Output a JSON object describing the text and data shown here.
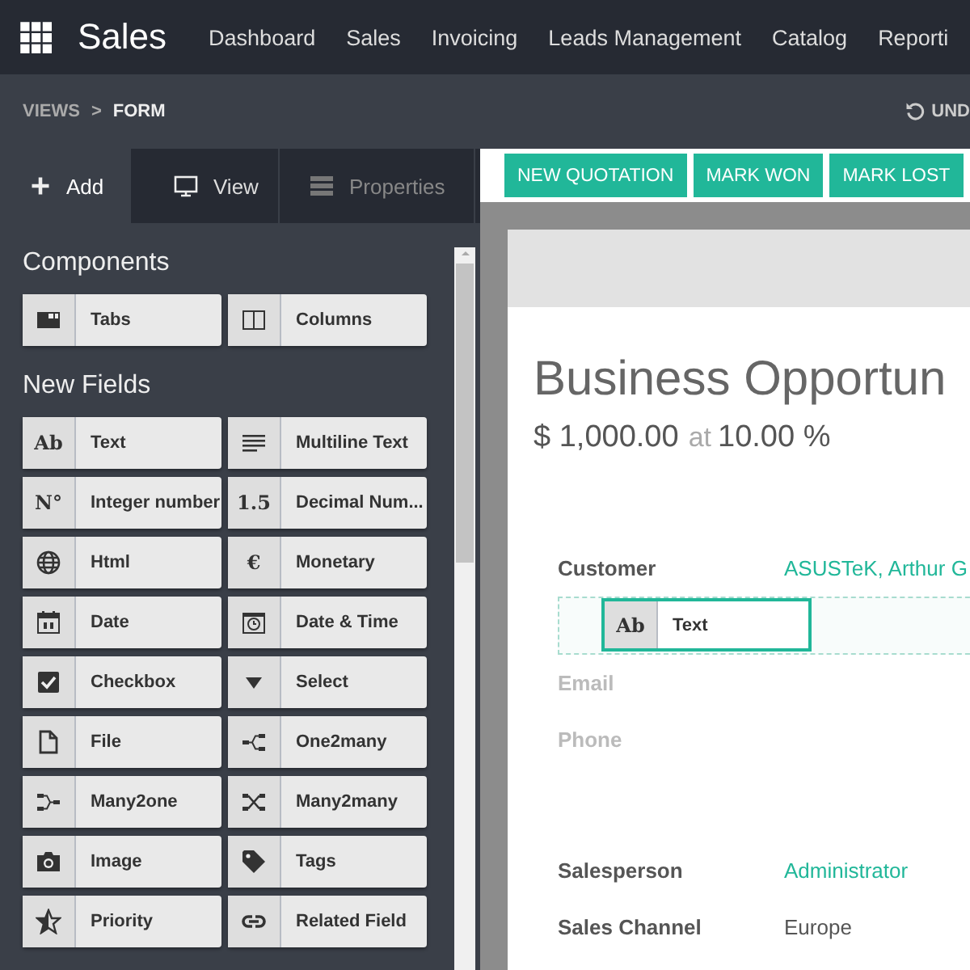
{
  "topbar": {
    "app": "Sales",
    "menu": [
      "Dashboard",
      "Sales",
      "Invoicing",
      "Leads Management",
      "Catalog",
      "Reporti"
    ]
  },
  "breadcrumb": {
    "items": [
      "VIEWS",
      "FORM"
    ],
    "separator": ">",
    "undo": "UND"
  },
  "sidebar": {
    "tabs": [
      {
        "label": "Add",
        "kind": "plus",
        "selected": true,
        "disabled": false
      },
      {
        "label": "View",
        "kind": "monitor",
        "selected": false,
        "disabled": false
      },
      {
        "label": "Properties",
        "kind": "server",
        "selected": false,
        "disabled": true
      }
    ],
    "sections": [
      {
        "title": "Components",
        "items": [
          {
            "label": "Tabs",
            "kind": "tabs"
          },
          {
            "label": "Columns",
            "kind": "columns"
          }
        ]
      },
      {
        "title": "New Fields",
        "items": [
          {
            "label": "Text",
            "kind": "glyph",
            "glyph": "Ab"
          },
          {
            "label": "Multiline Text",
            "kind": "lines"
          },
          {
            "label": "Integer number",
            "kind": "glyph",
            "glyph": "N°"
          },
          {
            "label": "Decimal Num...",
            "kind": "glyph",
            "glyph": "1.5"
          },
          {
            "label": "Html",
            "kind": "globe"
          },
          {
            "label": "Monetary",
            "kind": "glyph",
            "glyph": "€"
          },
          {
            "label": "Date",
            "kind": "calendar"
          },
          {
            "label": "Date & Time",
            "kind": "clock"
          },
          {
            "label": "Checkbox",
            "kind": "checkbox"
          },
          {
            "label": "Select",
            "kind": "caret"
          },
          {
            "label": "File",
            "kind": "file"
          },
          {
            "label": "One2many",
            "kind": "one2many"
          },
          {
            "label": "Many2one",
            "kind": "many2one"
          },
          {
            "label": "Many2many",
            "kind": "many2many"
          },
          {
            "label": "Image",
            "kind": "camera"
          },
          {
            "label": "Tags",
            "kind": "tag"
          },
          {
            "label": "Priority",
            "kind": "star"
          },
          {
            "label": "Related Field",
            "kind": "link"
          }
        ]
      }
    ]
  },
  "actions": [
    "NEW QUOTATION",
    "MARK WON",
    "MARK LOST"
  ],
  "form": {
    "title": "Business Opportun",
    "amount": "$ 1,000.00",
    "at": "at",
    "probability": "10.00 %",
    "fields": [
      {
        "label": "Customer",
        "value": "ASUSTeK, Arthur G",
        "kind": "link",
        "muted": false
      },
      {
        "kind": "dropzone"
      },
      {
        "label": "Email",
        "kind": "plain",
        "muted": true
      },
      {
        "label": "Phone",
        "kind": "plain",
        "muted": true
      },
      {
        "kind": "spacer"
      },
      {
        "label": "Salesperson",
        "value": "Administrator",
        "kind": "link",
        "muted": false
      },
      {
        "label": "Sales Channel",
        "value": "Europe",
        "kind": "plain",
        "muted": false
      }
    ]
  },
  "dragged": {
    "label": "Text",
    "glyph": "Ab"
  }
}
